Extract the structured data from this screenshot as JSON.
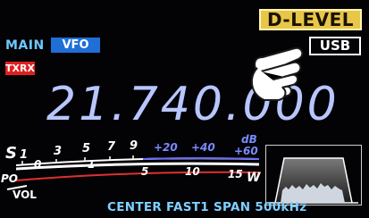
{
  "header": {
    "mode_tag": "D-LEVEL",
    "main_label": "MAIN",
    "vfo_label": "VFO",
    "txrx_label": "TXRX",
    "mode": "USB"
  },
  "frequency": "21.740.000",
  "meter": {
    "s_label": "S",
    "s_ticks": [
      "1",
      "3",
      "5",
      "7",
      "9",
      "+20",
      "+40"
    ],
    "db_label": "dB",
    "db_top": "+60",
    "po_label": "PO",
    "po_ticks": [
      "0",
      "1",
      "5",
      "10",
      "15"
    ],
    "po_unit": "W",
    "vol_label": "VOL"
  },
  "bottom": {
    "text": "CENTER FAST1 SPAN  500kHz"
  },
  "colors": {
    "accent_gold": "#e8c64a",
    "vfo_blue": "#1f6fd6",
    "tx_red": "#e02020",
    "frequency": "#b8c6ff"
  }
}
